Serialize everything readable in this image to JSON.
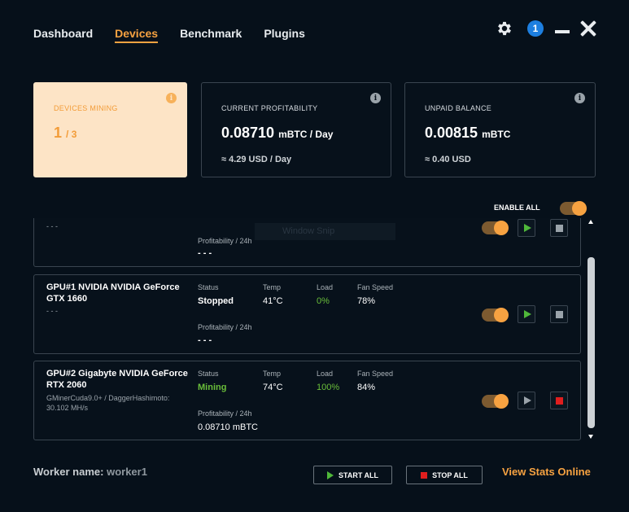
{
  "nav": {
    "tabs": [
      "Dashboard",
      "Devices",
      "Benchmark",
      "Plugins"
    ],
    "active": "Devices"
  },
  "header": {
    "notification_count": "1"
  },
  "cards": {
    "mining": {
      "label": "DEVICES MINING",
      "value": "1",
      "total": "/ 3"
    },
    "profit": {
      "label": "CURRENT PROFITABILITY",
      "value": "0.08710",
      "unit": "mBTC / Day",
      "sub": "≈ 4.29 USD / Day"
    },
    "balance": {
      "label": "UNPAID BALANCE",
      "value": "0.00815",
      "unit": "mBTC",
      "sub": "≈ 0.40 USD"
    }
  },
  "enable_all_label": "ENABLE ALL",
  "device_columns": {
    "status": "Status",
    "temp": "Temp",
    "load": "Load",
    "fan": "Fan Speed",
    "profit": "Profitability / 24h"
  },
  "devices": [
    {
      "name": "",
      "algo": "- - -",
      "status": "- -",
      "temp": "",
      "load": "",
      "fan": "",
      "profit": "- - -",
      "ghost_text": "Window Snip"
    },
    {
      "name": "GPU#1 NVIDIA NVIDIA GeForce GTX 1660",
      "algo": "- - -",
      "status": "Stopped",
      "temp": "41°C",
      "load": "0%",
      "fan": "78%",
      "profit": "- - -"
    },
    {
      "name": "GPU#2 Gigabyte NVIDIA GeForce RTX 2060",
      "algo": "GMinerCuda9.0+ / DaggerHashimoto: 30.102 MH/s",
      "status": "Mining",
      "temp": "74°C",
      "load": "100%",
      "fan": "84%",
      "profit": "0.08710 mBTC"
    }
  ],
  "footer": {
    "worker_label": "Worker name:",
    "worker_name": "worker1",
    "start_all": "START ALL",
    "stop_all": "STOP ALL",
    "stats_link": "View Stats Online"
  },
  "colors": {
    "accent": "#f7a241",
    "mining_green": "#6abf3a",
    "stop_red": "#e01e1e",
    "notif_blue": "#1d7fe0"
  }
}
